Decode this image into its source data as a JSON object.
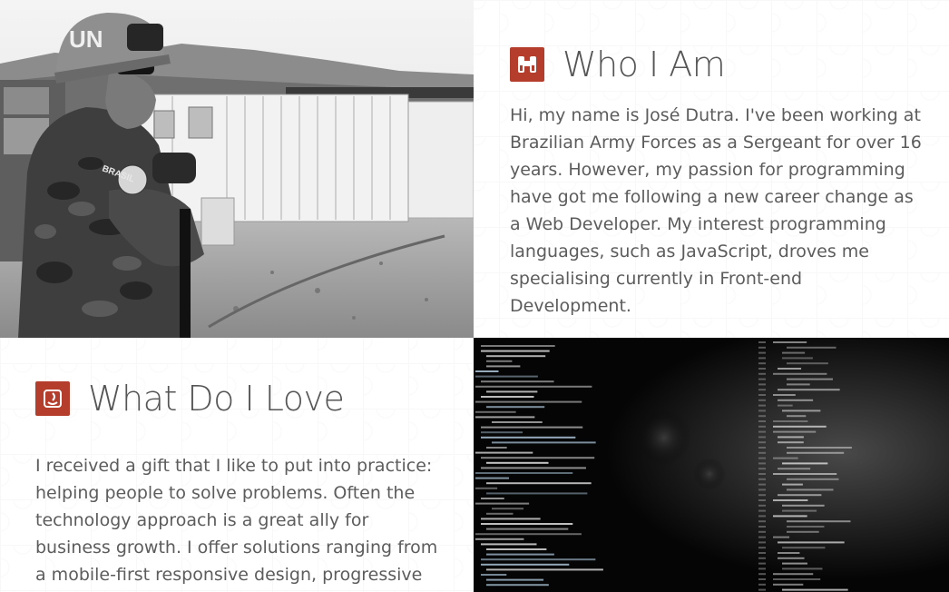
{
  "about": {
    "title": "Who I Am",
    "icon": "binoculars-icon",
    "text": "Hi, my name is José Dutra. I've been working at Brazilian Army Forces as a Sergeant for over 16 years. However, my passion for programming have got me following a new career change as a Web Developer. My interest programming languages, such as JavaScript, droves me specialising currently in Front-end Development."
  },
  "love": {
    "title": "What Do I Love",
    "icon": "heart-face-icon",
    "text": "I received a gift that I like to put into practice: helping people to solve problems. Often the technology approach is a great ally for business growth. I offer solutions ranging from a mobile-first responsive design, progressive"
  },
  "photo": {
    "helmet_text": "UN",
    "badge_text": "BRASIL",
    "description": "soldier-portrait"
  },
  "colors": {
    "accent": "#b53d2c",
    "text": "#5c5c5c",
    "heading": "#555555"
  }
}
